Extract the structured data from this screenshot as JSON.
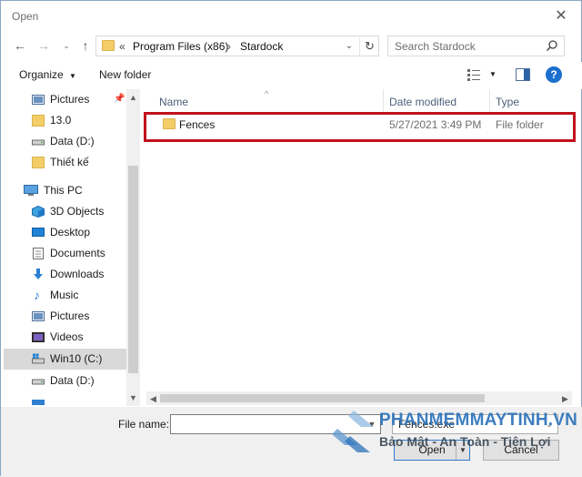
{
  "window": {
    "title": "Open"
  },
  "address": {
    "overflow": "«",
    "crumbs": [
      "Program Files (x86)",
      "Stardock"
    ],
    "separator": "›"
  },
  "search": {
    "placeholder": "Search Stardock"
  },
  "toolbar": {
    "organize": "Organize",
    "new_folder": "New folder"
  },
  "sidebar": {
    "items": [
      {
        "label": "Pictures",
        "icon": "pictures-icon",
        "pinned": true
      },
      {
        "label": "13.0",
        "icon": "folder-icon"
      },
      {
        "label": "Data (D:)",
        "icon": "drive-icon"
      },
      {
        "label": "Thiết kế",
        "icon": "folder-icon"
      },
      {
        "label": "This PC",
        "icon": "computer-icon"
      },
      {
        "label": "3D Objects",
        "icon": "3d-objects-icon"
      },
      {
        "label": "Desktop",
        "icon": "desktop-icon"
      },
      {
        "label": "Documents",
        "icon": "documents-icon"
      },
      {
        "label": "Downloads",
        "icon": "downloads-icon"
      },
      {
        "label": "Music",
        "icon": "music-icon"
      },
      {
        "label": "Pictures",
        "icon": "pictures-icon"
      },
      {
        "label": "Videos",
        "icon": "videos-icon"
      },
      {
        "label": "Win10 (C:)",
        "icon": "windows-drive-icon",
        "selected": true
      },
      {
        "label": "Data (D:)",
        "icon": "drive-icon"
      }
    ]
  },
  "columns": [
    "Name",
    "Date modified",
    "Type"
  ],
  "files": [
    {
      "name": "Fences",
      "date": "5/27/2021 3:49 PM",
      "type": "File folder"
    }
  ],
  "bottom": {
    "file_name_label": "File name:",
    "file_name_value": "",
    "filter": "Fences.exe",
    "open": "Open",
    "cancel": "Cancel"
  },
  "watermark": {
    "line1": "PHANMEMMAYTINH.VN",
    "line2": "Bảo Mật - An Toàn - Tiện Lợi"
  },
  "colors": {
    "highlight": "#c0111b",
    "accent": "#1c6fce",
    "folder": "#f3cd68",
    "watermark": "#2d73ba"
  }
}
